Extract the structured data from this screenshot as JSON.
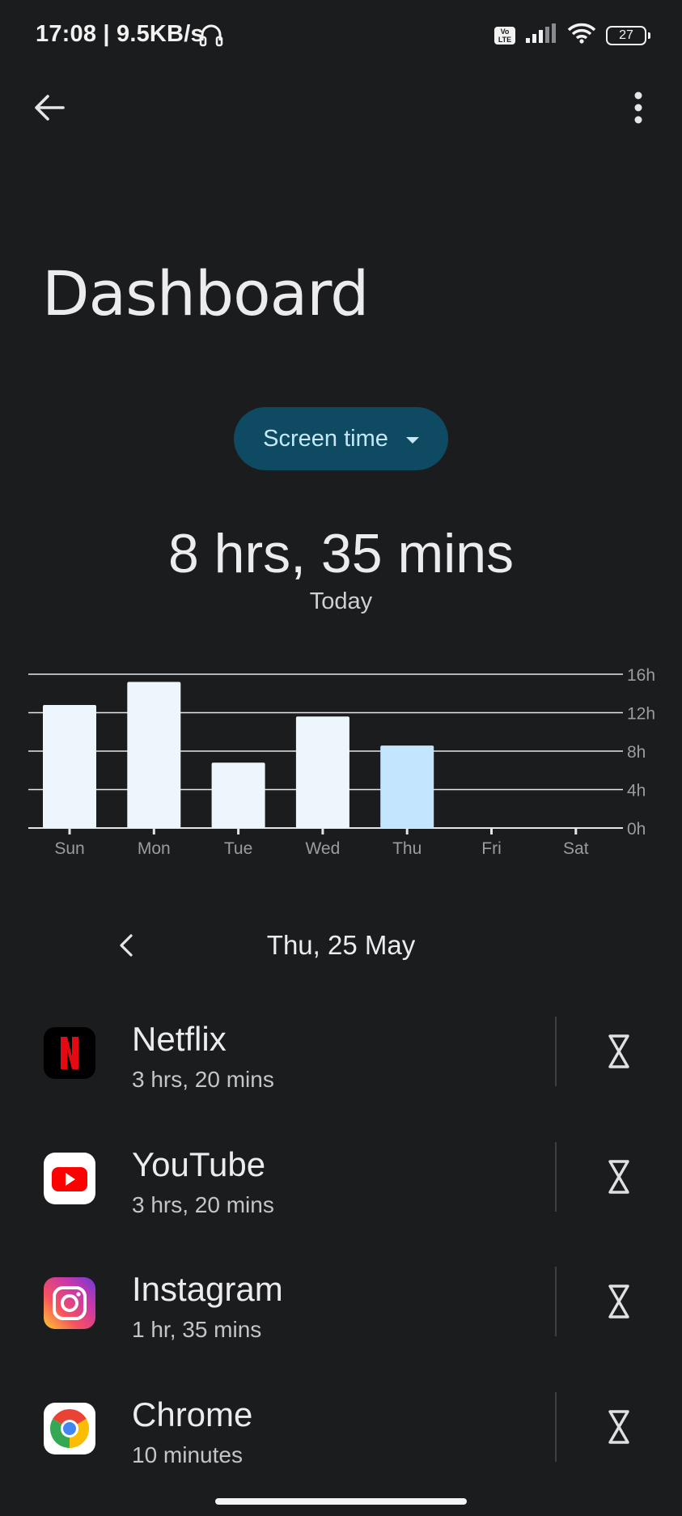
{
  "status_bar": {
    "time_speed": "17:08 | 9.5KB/s",
    "volte_label": "Vo LTE",
    "battery_level": "27",
    "icons": [
      "headset-icon",
      "volte-icon",
      "signal-icon",
      "wifi-icon",
      "battery-icon"
    ]
  },
  "app_bar": {
    "back_icon": "arrow-back-icon",
    "menu_icon": "more-vert-icon"
  },
  "page_title": "Dashboard",
  "metric_selector": {
    "label": "Screen time",
    "icon": "dropdown-caret-icon"
  },
  "summary": {
    "total": "8 hrs, 35 mins",
    "period": "Today"
  },
  "chart_data": {
    "type": "bar",
    "categories": [
      "Sun",
      "Mon",
      "Tue",
      "Wed",
      "Thu",
      "Fri",
      "Sat"
    ],
    "values": [
      12.8,
      15.2,
      6.8,
      11.6,
      8.58,
      0,
      0
    ],
    "selected_index": 4,
    "ylim": [
      0,
      16
    ],
    "yticks": [
      0,
      4,
      8,
      12,
      16
    ],
    "ytick_labels": [
      "0h",
      "4h",
      "8h",
      "12h",
      "16h"
    ],
    "grid": true,
    "colors": {
      "bar": "#eef6fd",
      "selected_bar": "#c3e5fe",
      "grid": "#e6e6e8"
    }
  },
  "date_nav": {
    "prev_icon": "chevron-left-icon",
    "date": "Thu, 25 May"
  },
  "apps": [
    {
      "name": "Netflix",
      "usage": "3 hrs, 20 mins",
      "icon": "netflix-icon",
      "timer_icon": "hourglass-icon"
    },
    {
      "name": "YouTube",
      "usage": "3 hrs, 20 mins",
      "icon": "youtube-icon",
      "timer_icon": "hourglass-icon"
    },
    {
      "name": "Instagram",
      "usage": "1 hr, 35 mins",
      "icon": "instagram-icon",
      "timer_icon": "hourglass-icon"
    },
    {
      "name": "Chrome",
      "usage": "10 minutes",
      "icon": "chrome-icon",
      "timer_icon": "hourglass-icon"
    }
  ],
  "colors": {
    "background": "#1b1c1e",
    "chip_bg": "#0e4a62",
    "chip_text": "#c6e8f6"
  }
}
